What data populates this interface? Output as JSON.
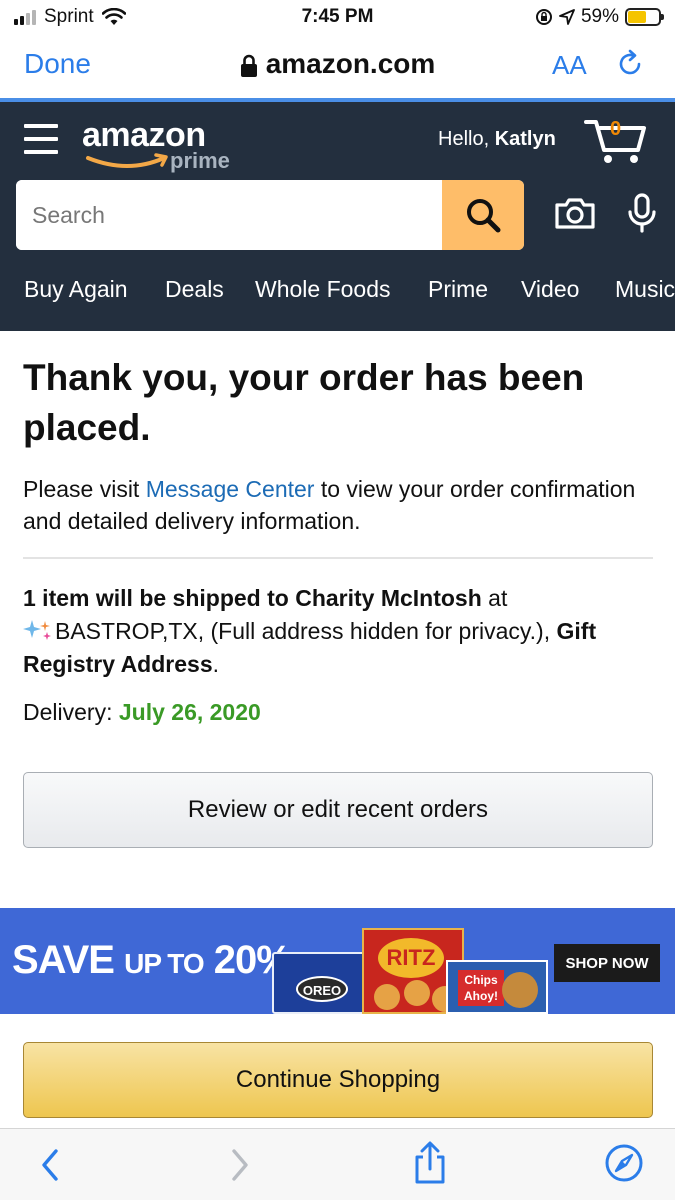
{
  "status_bar": {
    "carrier": "Sprint",
    "time": "7:45 PM",
    "battery_percent": "59%",
    "battery_level": 0.59,
    "battery_color": "#f5c400"
  },
  "browser": {
    "done_label": "Done",
    "url": "amazon.com",
    "text_size_label": "AA",
    "accent_color": "#2b7de9"
  },
  "amazon_header": {
    "logo_text": "amazon",
    "logo_sub": "prime",
    "greeting_prefix": "Hello,",
    "user_name": "Katlyn",
    "cart_count": "0",
    "search_placeholder": "Search",
    "nav_items": [
      "Buy Again",
      "Deals",
      "Whole Foods",
      "Prime",
      "Video",
      "Music"
    ],
    "background_color": "#232f3e",
    "search_button_color": "#febd69"
  },
  "confirmation": {
    "title": "Thank you, your order has been placed.",
    "visit_prefix": "Please visit",
    "message_center_link": "Message Center",
    "visit_suffix": "to view your order confirmation and detailed delivery information.",
    "ship_bold": "1 item will be shipped to Charity McIntosh",
    "ship_at": "at",
    "ship_address": "BASTROP,TX, (Full address hidden for privacy.),",
    "ship_registry": "Gift Registry Address",
    "ship_period": ".",
    "delivery_label": "Delivery:",
    "delivery_date": "July 26, 2020",
    "delivery_color": "#3a9a26",
    "review_button": "Review or edit recent orders"
  },
  "promo_banner": {
    "save_word": "SAVE",
    "up_to": "UP TO",
    "percent": "20%",
    "shop_now": "SHOP NOW",
    "oreo_label": "OREO",
    "ritz_label": "RITZ",
    "chips_ahoy_label": "Chips Ahoy!",
    "background_color": "#3f68d6"
  },
  "continue_button": "Continue Shopping",
  "toolbar": {
    "icons": [
      "back-icon",
      "forward-icon",
      "share-icon",
      "compass-icon"
    ]
  }
}
